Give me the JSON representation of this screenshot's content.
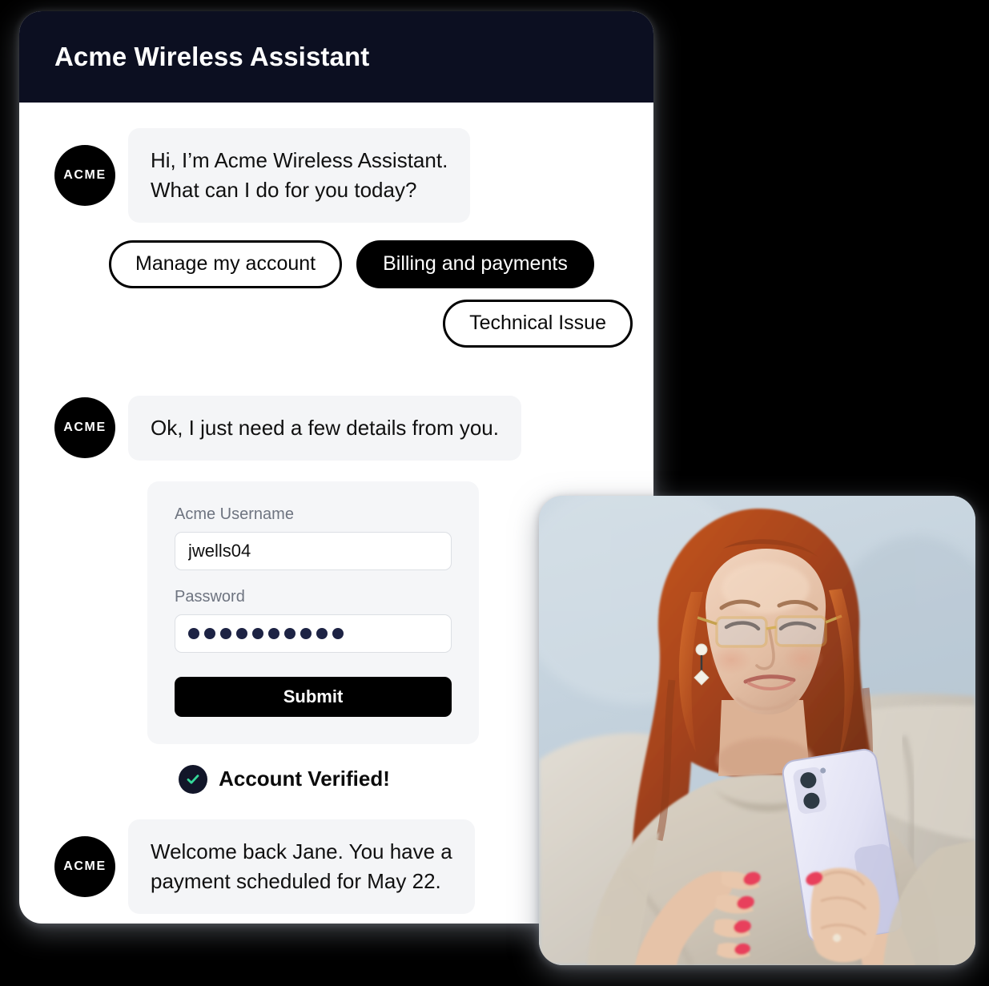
{
  "page": {
    "background_color": "#000000"
  },
  "chat_card": {
    "header": {
      "title": "Acme Wireless Assistant",
      "background_color": "#0c0f21",
      "text_color": "#ffffff"
    },
    "avatar_label": "ACME",
    "messages": [
      {
        "sender": "assistant",
        "avatar": "ACME",
        "line1": "Hi, I’m Acme Wireless Assistant.",
        "line2": "What can I do for you today?"
      },
      {
        "sender": "assistant",
        "avatar": "ACME",
        "line1": "Ok, I just need a few details from you."
      },
      {
        "sender": "assistant",
        "avatar": "ACME",
        "line1": "Welcome back Jane. You have a",
        "line2": "payment scheduled for May 22."
      }
    ],
    "quick_replies": [
      {
        "label": "Manage my account",
        "selected": false
      },
      {
        "label": "Billing and payments",
        "selected": true
      },
      {
        "label": "Technical Issue",
        "selected": false
      }
    ],
    "login_form": {
      "username_label": "Acme Username",
      "username_value": "jwells04",
      "username_placeholder": "Acme Username",
      "password_label": "Password",
      "password_masked": "●●●●●●●●●●",
      "password_dot_count": 10,
      "submit_label": "Submit"
    },
    "verified_status": {
      "text": "Account Verified!",
      "icon": "check-circle-icon",
      "icon_circle_color": "#121629",
      "check_color": "#35d99a"
    }
  },
  "photo_card": {
    "alt": "Older woman with long red hair and gold-rimmed glasses, wearing a beige top, sitting on a light sofa and smiling while using a white smartphone",
    "background_color": "#c6d4de"
  }
}
